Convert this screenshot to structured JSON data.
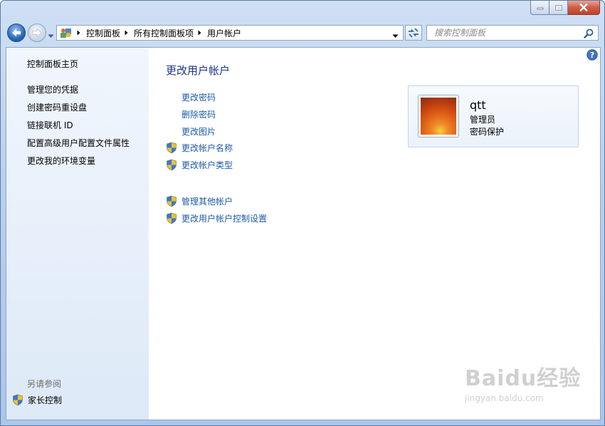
{
  "window": {
    "caption_buttons": [
      "minimize",
      "maximize",
      "close"
    ]
  },
  "nav": {
    "breadcrumbs": [
      "控制面板",
      "所有控制面板项",
      "用户帐户"
    ],
    "search_placeholder": "搜索控制面板"
  },
  "sidebar": {
    "home_label": "控制面板主页",
    "links": [
      "管理您的凭据",
      "创建密码重设盘",
      "链接联机 ID",
      "配置高级用户配置文件属性",
      "更改我的环境变量"
    ],
    "see_also_label": "另请参阅",
    "parental_control_label": "家长控制"
  },
  "main": {
    "title": "更改用户帐户",
    "tasks": [
      {
        "label": "更改密码",
        "shield": false
      },
      {
        "label": "删除密码",
        "shield": false
      },
      {
        "label": "更改图片",
        "shield": false
      },
      {
        "label": "更改帐户名称",
        "shield": true
      },
      {
        "label": "更改帐户类型",
        "shield": true
      }
    ],
    "other_tasks": [
      {
        "label": "管理其他帐户",
        "shield": true
      },
      {
        "label": "更改用户帐户控制设置",
        "shield": true
      }
    ]
  },
  "user": {
    "name": "qtt",
    "role": "管理员",
    "password_status": "密码保护"
  },
  "watermark": {
    "brand": "Baidu经验",
    "url": "jingyan.baidu.com"
  },
  "colors": {
    "link": "#1e5aa8",
    "title": "#1e3287",
    "sidebar_top": "#f1f6fd",
    "sidebar_bottom": "#dde9f7"
  }
}
